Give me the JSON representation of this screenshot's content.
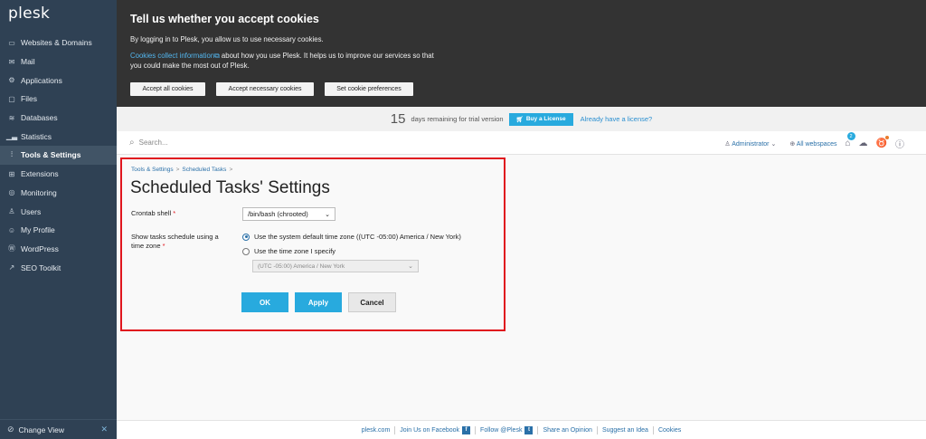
{
  "brand": "plesk",
  "sidebar": {
    "items": [
      {
        "label": "Websites & Domains",
        "icon": "monitor-icon"
      },
      {
        "label": "Mail",
        "icon": "mail-icon"
      },
      {
        "label": "Applications",
        "icon": "gear-icon"
      },
      {
        "label": "Files",
        "icon": "folder-icon"
      },
      {
        "label": "Databases",
        "icon": "database-icon"
      },
      {
        "label": "Statistics",
        "icon": "chart-icon"
      },
      {
        "label": "Tools & Settings",
        "icon": "tools-icon",
        "active": true
      },
      {
        "label": "Extensions",
        "icon": "extensions-icon"
      },
      {
        "label": "Monitoring",
        "icon": "monitoring-icon"
      },
      {
        "label": "Users",
        "icon": "user-icon"
      },
      {
        "label": "My Profile",
        "icon": "profile-icon"
      },
      {
        "label": "WordPress",
        "icon": "wordpress-icon"
      },
      {
        "label": "SEO Toolkit",
        "icon": "seo-icon"
      }
    ],
    "change_view": "Change View"
  },
  "cookie_banner": {
    "title": "Tell us whether you accept cookies",
    "text1": "By logging in to Plesk, you allow us to use necessary cookies.",
    "link": "Cookies collect information",
    "text2a": " about how you use Plesk. It helps us to improve our services so that",
    "text2b": "you could make the most out of Plesk.",
    "btn_accept_all": "Accept all cookies",
    "btn_accept_necessary": "Accept necessary cookies",
    "btn_preferences": "Set cookie preferences"
  },
  "trial": {
    "days": "15",
    "text": "days remaining for trial version",
    "buy": "Buy a License",
    "have": "Already have a license?"
  },
  "header": {
    "search_placeholder": "Search...",
    "user": "Administrator",
    "webspaces": "All webspaces",
    "notifications_count": "2"
  },
  "breadcrumb": {
    "item1": "Tools & Settings",
    "item2": "Scheduled Tasks",
    "sep": ">"
  },
  "page_title": "Scheduled Tasks' Settings",
  "form": {
    "crontab_label": "Crontab shell",
    "crontab_value": "/bin/bash (chrooted)",
    "tz_label_1": "Show tasks schedule using a",
    "tz_label_2": "time zone",
    "required_mark": "*",
    "radio_default": "Use the system default time zone ((UTC -05:00) America / New York)",
    "radio_specify": "Use the time zone I specify",
    "tz_select_value": "(UTC -05:00) America / New York",
    "ok": "OK",
    "apply": "Apply",
    "cancel": "Cancel"
  },
  "footer": {
    "site": "plesk.com",
    "facebook": "Join Us on Facebook",
    "twitter": "Follow @Plesk",
    "opinion": "Share an Opinion",
    "idea": "Suggest an Idea",
    "cookies": "Cookies"
  },
  "colors": {
    "sidebar_bg": "#2f4154",
    "accent": "#28aade",
    "highlight_border": "#e0161e"
  }
}
